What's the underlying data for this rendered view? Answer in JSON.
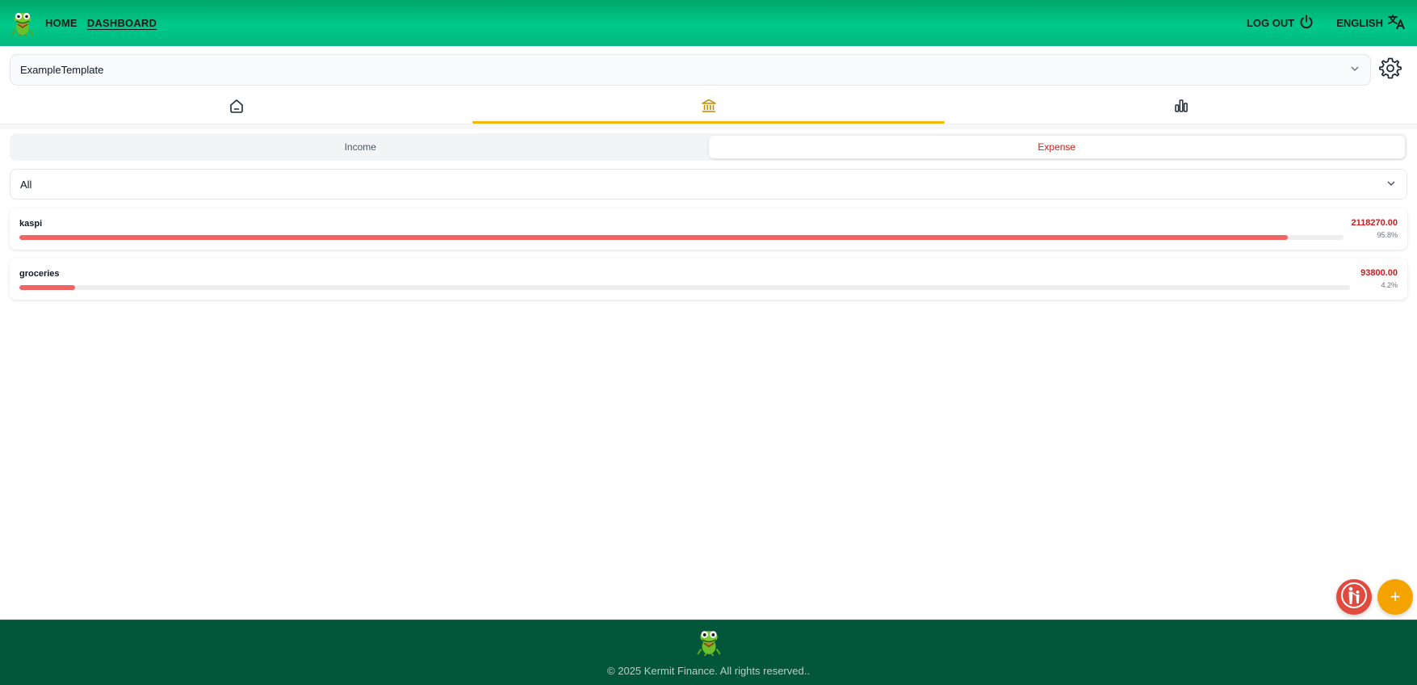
{
  "header": {
    "logo_icon": "frog-logo-icon",
    "nav": [
      {
        "label": "HOME",
        "active": false
      },
      {
        "label": "DASHBOARD",
        "active": true
      }
    ],
    "logout_label": "LOG OUT",
    "logout_icon": "power-icon",
    "language_label": "ENGLISH",
    "language_icon": "translate-icon",
    "background_color": "#00c98a"
  },
  "template": {
    "selected": "ExampleTemplate",
    "dropdown_icon": "chevron-down-icon",
    "settings_icon": "gear-icon"
  },
  "main_tabs": [
    {
      "icon": "home-icon",
      "active": false
    },
    {
      "icon": "bank-icon",
      "active": true
    },
    {
      "icon": "bar-chart-icon",
      "active": false
    }
  ],
  "switcher": {
    "options": [
      "Income",
      "Expense"
    ],
    "active": "Expense"
  },
  "filter": {
    "selected": "All",
    "dropdown_icon": "chevron-down-icon"
  },
  "categories": [
    {
      "name": "kaspi",
      "amount": "2118270.00",
      "percent": "95.8%",
      "fill_fraction": 0.958
    },
    {
      "name": "groceries",
      "amount": "93800.00",
      "percent": "4.2%",
      "fill_fraction": 0.042
    }
  ],
  "fab": {
    "help_icon": "family-icon",
    "add_label": "+"
  },
  "footer": {
    "logo_icon": "frog-logo-icon",
    "copyright": "© 2025 Kermit Finance. All rights reserved.."
  },
  "colors": {
    "accent_tab": "#f5b800",
    "expense_red": "#c81e1e",
    "bar_fill": "#f06464",
    "footer_bg": "#02573a",
    "fab_add": "#f5a300",
    "fab_help": "#e04a3f"
  }
}
